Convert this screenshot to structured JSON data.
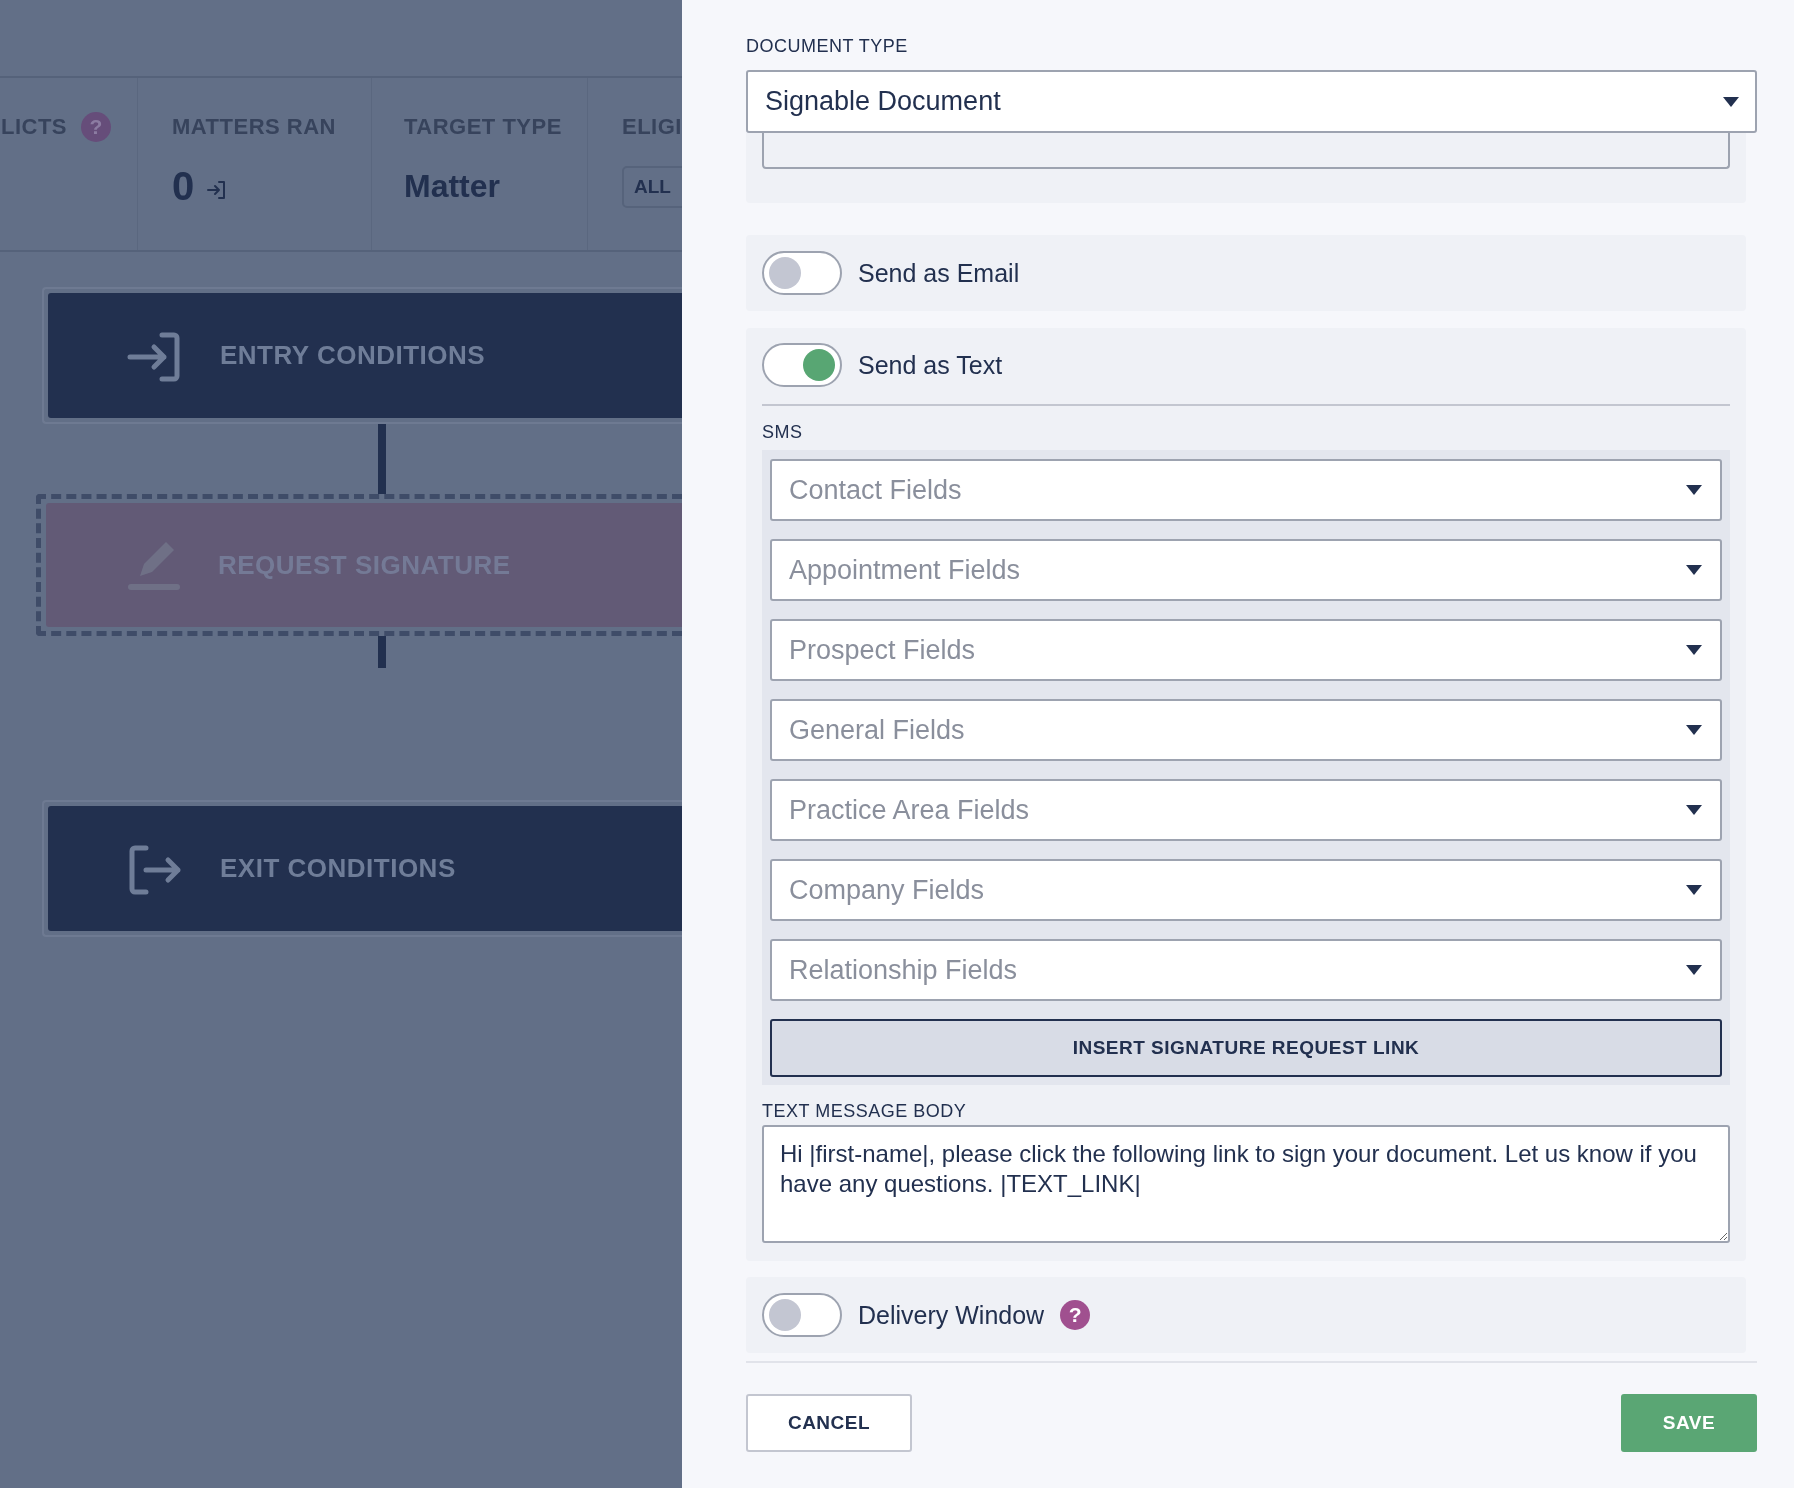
{
  "background": {
    "stats": [
      {
        "kind": "help",
        "label": "LICTS",
        "help": "?"
      },
      {
        "kind": "count",
        "label": "MATTERS RAN",
        "value": "0"
      },
      {
        "kind": "text",
        "label": "TARGET TYPE",
        "value": "Matter"
      },
      {
        "kind": "chip",
        "label": "ELIGI",
        "value": "ALL"
      }
    ],
    "flow": [
      {
        "kind": "entry",
        "label": "ENTRY CONDITIONS",
        "selected": false
      },
      {
        "kind": "signature",
        "label": "REQUEST SIGNATURE",
        "selected": true
      },
      {
        "kind": "exit",
        "label": "EXIT CONDITIONS",
        "selected": false
      }
    ]
  },
  "panel": {
    "document_type": {
      "label": "DOCUMENT TYPE",
      "value": "Signable Document"
    },
    "send_email": {
      "label": "Send as Email",
      "on": false
    },
    "send_text": {
      "label": "Send as Text",
      "on": true
    },
    "sms": {
      "label": "SMS",
      "dropdowns": [
        {
          "placeholder": "Contact Fields"
        },
        {
          "placeholder": "Appointment Fields"
        },
        {
          "placeholder": "Prospect Fields"
        },
        {
          "placeholder": "General Fields"
        },
        {
          "placeholder": "Practice Area Fields"
        },
        {
          "placeholder": "Company Fields"
        },
        {
          "placeholder": "Relationship Fields"
        }
      ],
      "insert_button": "INSERT SIGNATURE REQUEST LINK"
    },
    "message_body": {
      "label": "TEXT MESSAGE BODY",
      "value": "Hi |first-name|, please click the following link to sign your document. Let us know if you have any questions. |TEXT_LINK|"
    },
    "delivery_window": {
      "label": "Delivery Window",
      "on": false,
      "help": "?"
    },
    "buttons": {
      "cancel": "CANCEL",
      "save": "SAVE"
    }
  }
}
